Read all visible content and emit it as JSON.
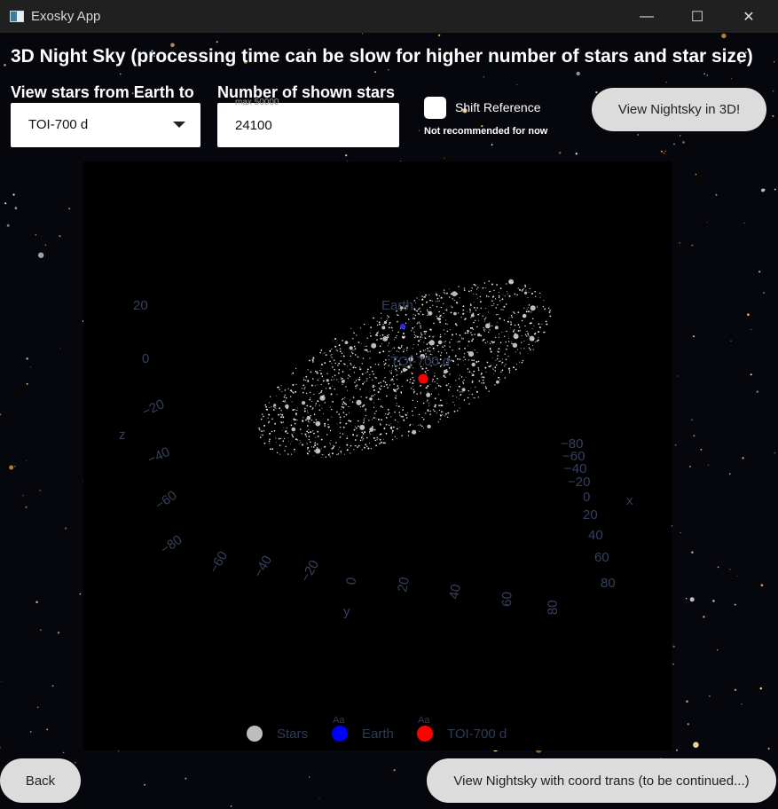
{
  "window": {
    "title": "Exosky App"
  },
  "heading": "3D Night Sky (processing time can be slow for higher number of stars and star size)",
  "controls": {
    "view_from_label": "View stars from Earth to",
    "planet_selected": "TOI-700 d",
    "num_stars_label": "Number of shown stars",
    "num_stars_placeholder": "max 50000",
    "num_stars_value": "24100",
    "shift_reference_label": "Shift Reference",
    "shift_reference_checked": false,
    "warning": "Not recommended for now",
    "view_3d_button": "View Nightsky in 3D!"
  },
  "plot": {
    "earth_label": "Earth",
    "planet_label": "TOI-700 d",
    "z_axis": {
      "title": "z",
      "ticks": [
        "20",
        "0",
        "−20",
        "−40",
        "−60",
        "−80"
      ]
    },
    "y_axis": {
      "title": "y",
      "ticks": [
        "−60",
        "−40",
        "−20",
        "0",
        "20",
        "40",
        "60",
        "80"
      ]
    },
    "x_axis": {
      "title": "x",
      "ticks": [
        "−80",
        "−60",
        "−40",
        "−20",
        "0",
        "20",
        "40",
        "60",
        "80"
      ]
    },
    "legend": {
      "items": [
        {
          "name": "Stars",
          "color": "#bdbdbd",
          "badge": ""
        },
        {
          "name": "Earth",
          "color": "#0000ff",
          "badge": "Aa"
        },
        {
          "name": "TOI-700 d",
          "color": "#ff0000",
          "badge": "Aa"
        }
      ]
    }
  },
  "footer": {
    "back_button": "Back",
    "coord_trans_button": "View Nightsky with coord trans (to be continued...)"
  }
}
